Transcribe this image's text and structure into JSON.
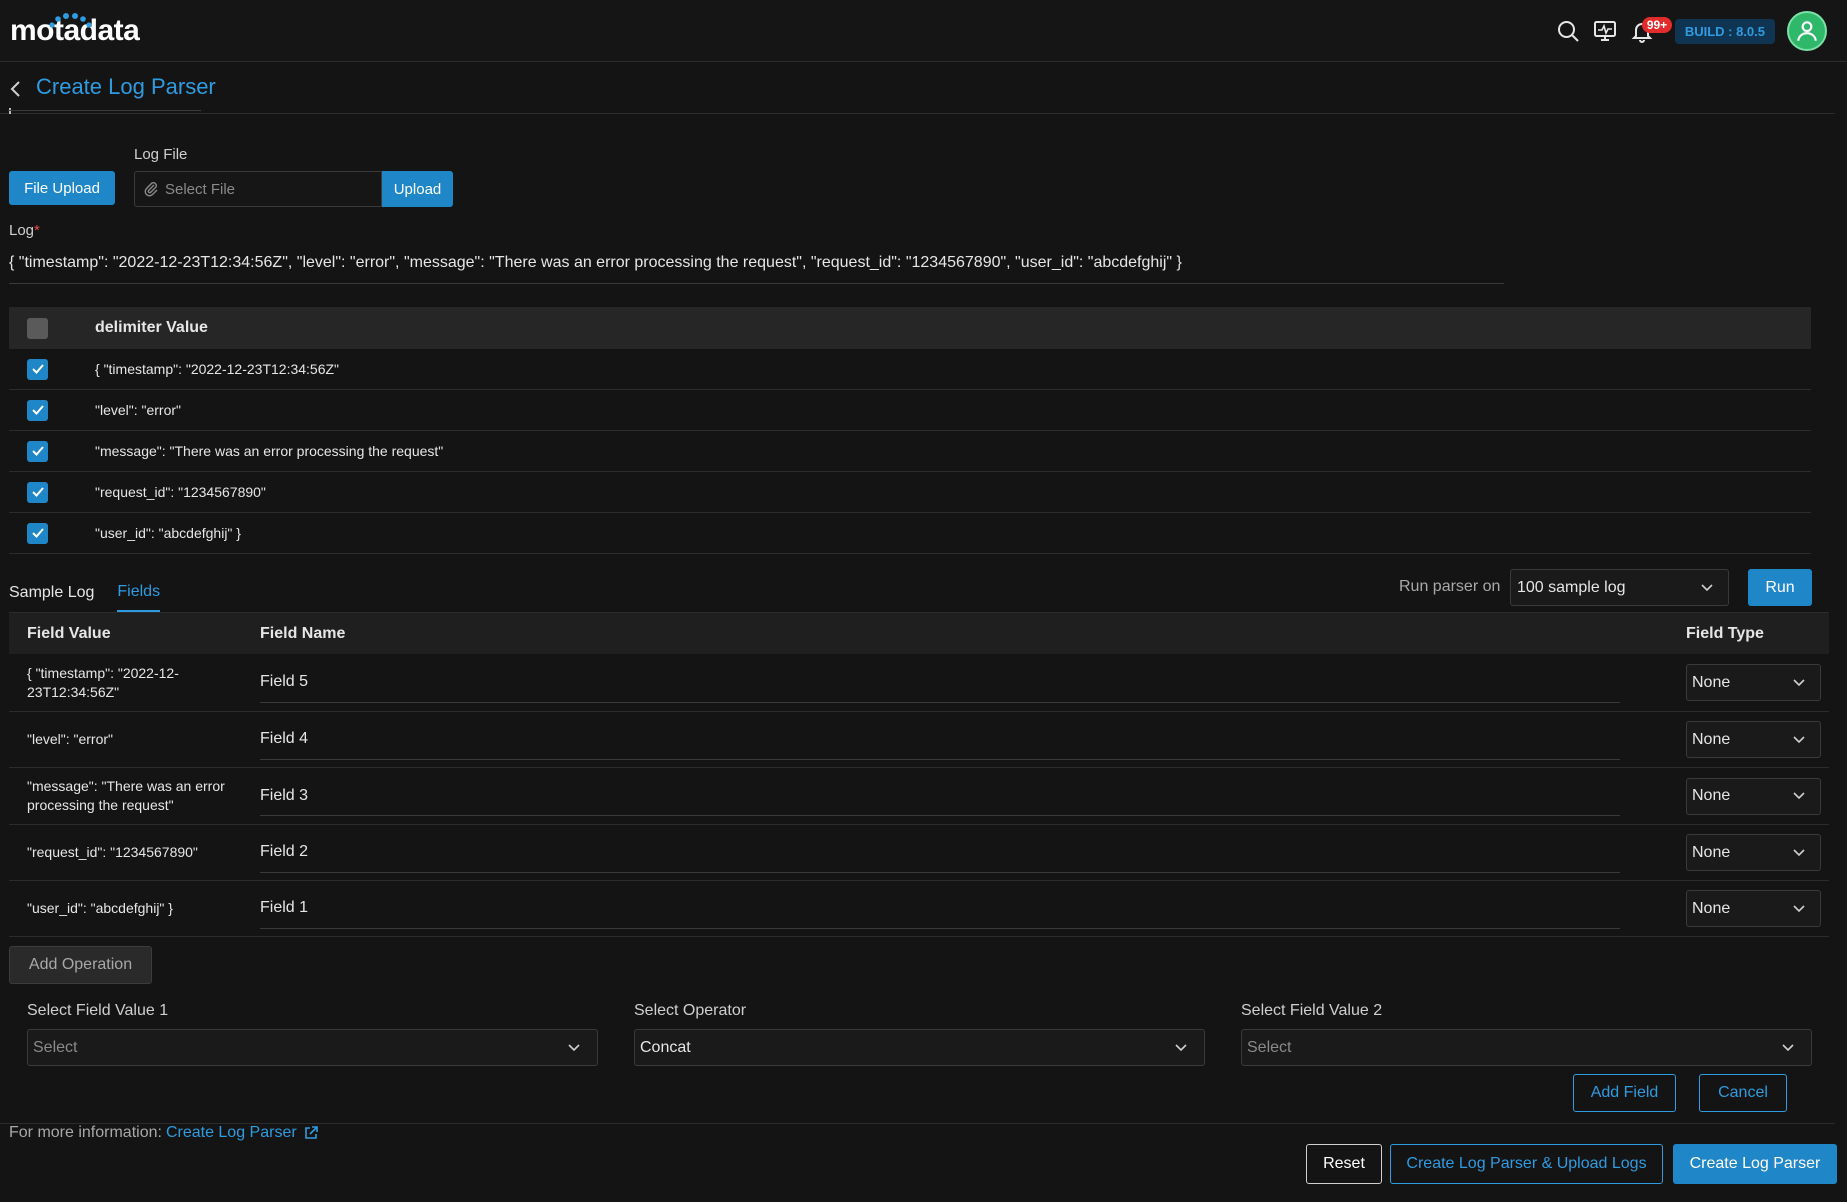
{
  "header": {
    "logo_text": "motadata",
    "notification_count": "99+",
    "build": "BUILD : 8.0.5"
  },
  "page": {
    "title": "Create Log Parser"
  },
  "upload": {
    "file_upload_label": "File Upload",
    "log_file_label": "Log File",
    "file_placeholder": "Select File",
    "upload_label": "Upload"
  },
  "log": {
    "label": "Log",
    "required_mark": "*",
    "value": "{ \"timestamp\": \"2022-12-23T12:34:56Z\", \"level\": \"error\", \"message\": \"There was an error processing the request\", \"request_id\": \"1234567890\", \"user_id\": \"abcdefghij\" }"
  },
  "delimiter_table": {
    "header": "delimiter Value",
    "rows": [
      "{ \"timestamp\": \"2022-12-23T12:34:56Z\"",
      "\"level\": \"error\"",
      "\"message\": \"There was an error processing the request\"",
      "\"request_id\": \"1234567890\"",
      "\"user_id\": \"abcdefghij\" }"
    ]
  },
  "tabs": [
    "Sample Log",
    "Fields"
  ],
  "run": {
    "label": "Run parser on",
    "selected": "100 sample log",
    "button": "Run"
  },
  "fields_table": {
    "headers": [
      "Field Value",
      "Field Name",
      "Field Type"
    ],
    "rows": [
      {
        "value": "{ \"timestamp\": \"2022-12-23T12:34:56Z\"",
        "name": "Field 5",
        "type": "None"
      },
      {
        "value": "\"level\": \"error\"",
        "name": "Field 4",
        "type": "None"
      },
      {
        "value": "\"message\": \"There was an error processing the request\"",
        "name": "Field 3",
        "type": "None"
      },
      {
        "value": "\"request_id\": \"1234567890\"",
        "name": "Field 2",
        "type": "None"
      },
      {
        "value": "\"user_id\": \"abcdefghij\" }",
        "name": "Field 1",
        "type": "None"
      }
    ]
  },
  "operation": {
    "add_label": "Add Operation",
    "field1_label": "Select Field Value 1",
    "field1_value": "Select",
    "operator_label": "Select Operator",
    "operator_value": "Concat",
    "field2_label": "Select Field Value 2",
    "field2_value": "Select",
    "add_field": "Add Field",
    "cancel": "Cancel"
  },
  "footer": {
    "more_info": "For more information:",
    "link": "Create Log Parser",
    "reset": "Reset",
    "create_upload": "Create Log Parser & Upload Logs",
    "create": "Create Log Parser"
  },
  "colors": {
    "accent": "#1f86c8",
    "link": "#2f9be0",
    "background": "#141414"
  }
}
